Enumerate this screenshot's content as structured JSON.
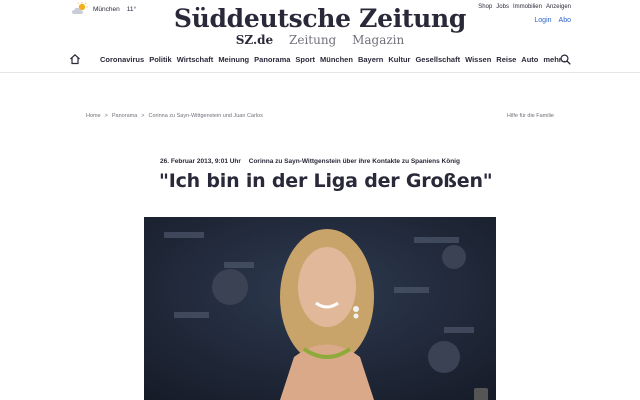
{
  "weather": {
    "city": "München",
    "temp": "11°",
    "icon": "partly-cloudy-icon"
  },
  "brand": {
    "logo": "Süddeutsche Zeitung"
  },
  "subnav": [
    "SZ.de",
    "Zeitung",
    "Magazin"
  ],
  "toplinks": [
    "Shop",
    "Jobs",
    "Immobilien",
    "Anzeigen"
  ],
  "account": {
    "login": "Login",
    "abo": "Abo"
  },
  "nav": {
    "items": [
      "Coronavirus",
      "Politik",
      "Wirtschaft",
      "Meinung",
      "Panorama",
      "Sport",
      "München",
      "Bayern",
      "Kultur",
      "Gesellschaft",
      "Wissen",
      "Reise",
      "Auto",
      "mehr..."
    ],
    "home_icon": "home-icon",
    "search_icon": "search-icon"
  },
  "breadcrumb": {
    "items": [
      "Home",
      "Panorama",
      "Corinna zu Sayn-Wittgenstein und Juan Carlos"
    ],
    "separator": ">",
    "right": "Hilfe für die Familie"
  },
  "article": {
    "date": "26. Februar 2013, 9:01 Uhr",
    "kicker": "Corinna zu Sayn-Wittgenstein über ihre Kontakte zu Spaniens König",
    "headline": "\"Ich bin in der Liga der Großen\""
  },
  "colors": {
    "accent": "#2c64c8",
    "text": "#29293a",
    "muted": "#71717a"
  }
}
